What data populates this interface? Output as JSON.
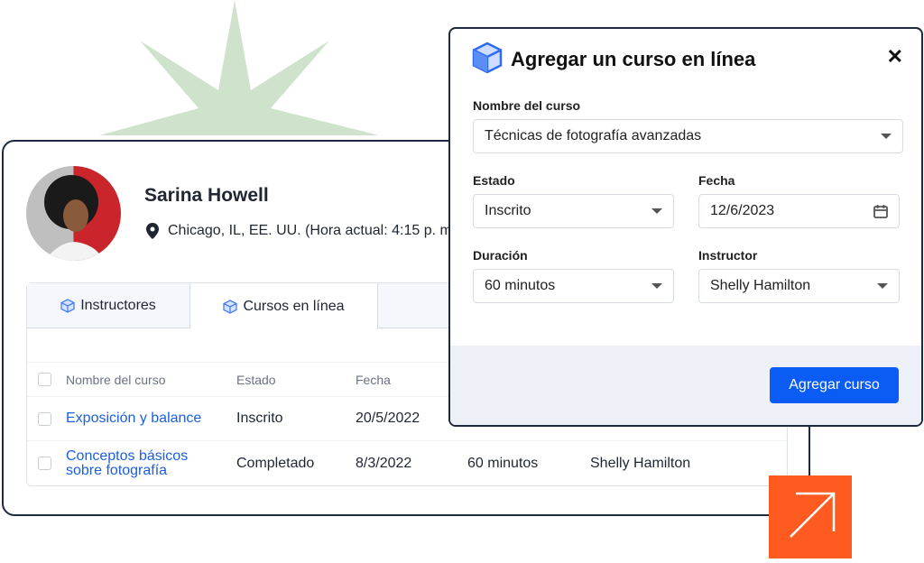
{
  "profile": {
    "name": "Sarina Howell",
    "location": "Chicago, IL, EE. UU. (Hora actual: 4:15 p. m"
  },
  "tabs": [
    {
      "label": "Instructores",
      "icon": "cube-icon"
    },
    {
      "label": "Cursos en línea",
      "icon": "cube-icon",
      "active": true
    }
  ],
  "table": {
    "headers": [
      "Nombre del curso",
      "Estado",
      "Fecha"
    ],
    "rows": [
      {
        "name": "Exposición y balance",
        "status": "Inscrito",
        "date": "20/5/2022"
      },
      {
        "name": "Conceptos básicos sobre fotografía",
        "status": "Completado",
        "date": "8/3/2022",
        "duration": "60 minutos",
        "instructor": "Shelly Hamilton"
      }
    ]
  },
  "dialog": {
    "title": "Agregar un curso en línea",
    "close": "✕",
    "course_label": "Nombre del curso",
    "course_value": "Técnicas de fotografía avanzadas",
    "status_label": "Estado",
    "status_value": "Inscrito",
    "date_label": "Fecha",
    "date_value": "12/6/2023",
    "duration_label": "Duración",
    "duration_value": "60 minutos",
    "instructor_label": "Instructor",
    "instructor_value": "Shelly Hamilton",
    "submit": "Agregar curso"
  },
  "colors": {
    "accent": "#0a5cf5",
    "link": "#1b5fe0",
    "orange": "#ff5a1f",
    "star": "#cfe3cc"
  }
}
